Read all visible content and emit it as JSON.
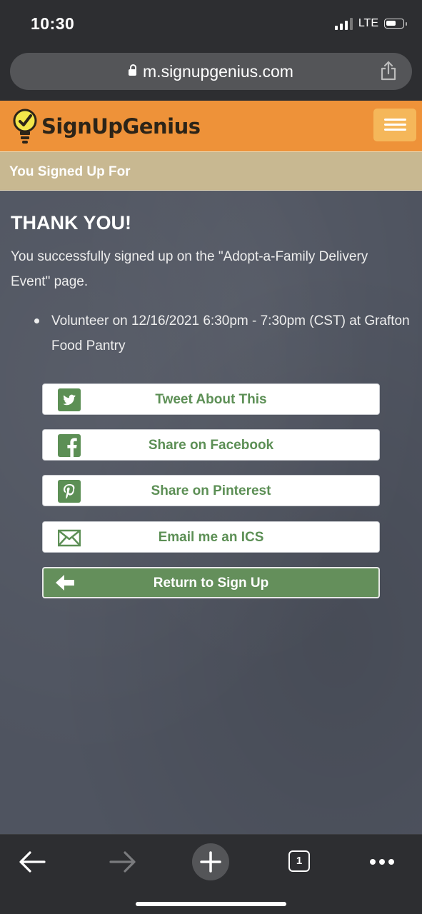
{
  "status_bar": {
    "time": "10:30",
    "network": "LTE"
  },
  "browser": {
    "url": "m.signupgenius.com"
  },
  "site": {
    "logo_text": "SignUpGenius",
    "brand_color": "#ee9239"
  },
  "section": {
    "title": "You Signed Up For"
  },
  "content": {
    "heading": "THANK YOU!",
    "message": "You successfully signed up on the \"Adopt-a-Family Delivery Event\" page.",
    "signups": [
      "Volunteer on 12/16/2021 6:30pm - 7:30pm (CST) at Grafton Food Pantry"
    ]
  },
  "actions": {
    "tweet_label": "Tweet About This",
    "facebook_label": "Share on Facebook",
    "pinterest_label": "Share on Pinterest",
    "email_label": "Email me an ICS",
    "return_label": "Return to Sign Up",
    "accent_color": "#648f5b"
  },
  "toolbar": {
    "tab_count": "1"
  }
}
